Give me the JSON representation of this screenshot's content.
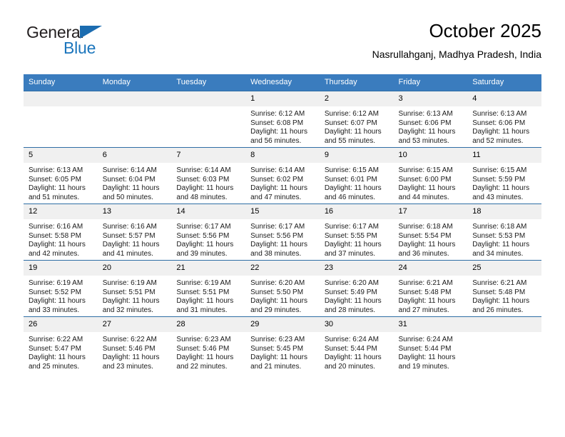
{
  "brand": {
    "name_part1": "General",
    "name_part2": "Blue",
    "flag_icon": "flag-triangle-icon",
    "accent_color": "#1b75bc"
  },
  "header": {
    "title": "October 2025",
    "location": "Nasrullahganj, Madhya Pradesh, India"
  },
  "theme": {
    "header_row_bg": "#3a7cbe",
    "day_number_bg": "#f0f0f0",
    "row_divider": "#2f6ea5"
  },
  "weekdays": [
    "Sunday",
    "Monday",
    "Tuesday",
    "Wednesday",
    "Thursday",
    "Friday",
    "Saturday"
  ],
  "weeks": [
    [
      {
        "day": "",
        "empty": true
      },
      {
        "day": "",
        "empty": true
      },
      {
        "day": "",
        "empty": true
      },
      {
        "day": "1",
        "sunrise": "Sunrise: 6:12 AM",
        "sunset": "Sunset: 6:08 PM",
        "daylight": "Daylight: 11 hours and 56 minutes."
      },
      {
        "day": "2",
        "sunrise": "Sunrise: 6:12 AM",
        "sunset": "Sunset: 6:07 PM",
        "daylight": "Daylight: 11 hours and 55 minutes."
      },
      {
        "day": "3",
        "sunrise": "Sunrise: 6:13 AM",
        "sunset": "Sunset: 6:06 PM",
        "daylight": "Daylight: 11 hours and 53 minutes."
      },
      {
        "day": "4",
        "sunrise": "Sunrise: 6:13 AM",
        "sunset": "Sunset: 6:06 PM",
        "daylight": "Daylight: 11 hours and 52 minutes."
      }
    ],
    [
      {
        "day": "5",
        "sunrise": "Sunrise: 6:13 AM",
        "sunset": "Sunset: 6:05 PM",
        "daylight": "Daylight: 11 hours and 51 minutes."
      },
      {
        "day": "6",
        "sunrise": "Sunrise: 6:14 AM",
        "sunset": "Sunset: 6:04 PM",
        "daylight": "Daylight: 11 hours and 50 minutes."
      },
      {
        "day": "7",
        "sunrise": "Sunrise: 6:14 AM",
        "sunset": "Sunset: 6:03 PM",
        "daylight": "Daylight: 11 hours and 48 minutes."
      },
      {
        "day": "8",
        "sunrise": "Sunrise: 6:14 AM",
        "sunset": "Sunset: 6:02 PM",
        "daylight": "Daylight: 11 hours and 47 minutes."
      },
      {
        "day": "9",
        "sunrise": "Sunrise: 6:15 AM",
        "sunset": "Sunset: 6:01 PM",
        "daylight": "Daylight: 11 hours and 46 minutes."
      },
      {
        "day": "10",
        "sunrise": "Sunrise: 6:15 AM",
        "sunset": "Sunset: 6:00 PM",
        "daylight": "Daylight: 11 hours and 44 minutes."
      },
      {
        "day": "11",
        "sunrise": "Sunrise: 6:15 AM",
        "sunset": "Sunset: 5:59 PM",
        "daylight": "Daylight: 11 hours and 43 minutes."
      }
    ],
    [
      {
        "day": "12",
        "sunrise": "Sunrise: 6:16 AM",
        "sunset": "Sunset: 5:58 PM",
        "daylight": "Daylight: 11 hours and 42 minutes."
      },
      {
        "day": "13",
        "sunrise": "Sunrise: 6:16 AM",
        "sunset": "Sunset: 5:57 PM",
        "daylight": "Daylight: 11 hours and 41 minutes."
      },
      {
        "day": "14",
        "sunrise": "Sunrise: 6:17 AM",
        "sunset": "Sunset: 5:56 PM",
        "daylight": "Daylight: 11 hours and 39 minutes."
      },
      {
        "day": "15",
        "sunrise": "Sunrise: 6:17 AM",
        "sunset": "Sunset: 5:56 PM",
        "daylight": "Daylight: 11 hours and 38 minutes."
      },
      {
        "day": "16",
        "sunrise": "Sunrise: 6:17 AM",
        "sunset": "Sunset: 5:55 PM",
        "daylight": "Daylight: 11 hours and 37 minutes."
      },
      {
        "day": "17",
        "sunrise": "Sunrise: 6:18 AM",
        "sunset": "Sunset: 5:54 PM",
        "daylight": "Daylight: 11 hours and 36 minutes."
      },
      {
        "day": "18",
        "sunrise": "Sunrise: 6:18 AM",
        "sunset": "Sunset: 5:53 PM",
        "daylight": "Daylight: 11 hours and 34 minutes."
      }
    ],
    [
      {
        "day": "19",
        "sunrise": "Sunrise: 6:19 AM",
        "sunset": "Sunset: 5:52 PM",
        "daylight": "Daylight: 11 hours and 33 minutes."
      },
      {
        "day": "20",
        "sunrise": "Sunrise: 6:19 AM",
        "sunset": "Sunset: 5:51 PM",
        "daylight": "Daylight: 11 hours and 32 minutes."
      },
      {
        "day": "21",
        "sunrise": "Sunrise: 6:19 AM",
        "sunset": "Sunset: 5:51 PM",
        "daylight": "Daylight: 11 hours and 31 minutes."
      },
      {
        "day": "22",
        "sunrise": "Sunrise: 6:20 AM",
        "sunset": "Sunset: 5:50 PM",
        "daylight": "Daylight: 11 hours and 29 minutes."
      },
      {
        "day": "23",
        "sunrise": "Sunrise: 6:20 AM",
        "sunset": "Sunset: 5:49 PM",
        "daylight": "Daylight: 11 hours and 28 minutes."
      },
      {
        "day": "24",
        "sunrise": "Sunrise: 6:21 AM",
        "sunset": "Sunset: 5:48 PM",
        "daylight": "Daylight: 11 hours and 27 minutes."
      },
      {
        "day": "25",
        "sunrise": "Sunrise: 6:21 AM",
        "sunset": "Sunset: 5:48 PM",
        "daylight": "Daylight: 11 hours and 26 minutes."
      }
    ],
    [
      {
        "day": "26",
        "sunrise": "Sunrise: 6:22 AM",
        "sunset": "Sunset: 5:47 PM",
        "daylight": "Daylight: 11 hours and 25 minutes."
      },
      {
        "day": "27",
        "sunrise": "Sunrise: 6:22 AM",
        "sunset": "Sunset: 5:46 PM",
        "daylight": "Daylight: 11 hours and 23 minutes."
      },
      {
        "day": "28",
        "sunrise": "Sunrise: 6:23 AM",
        "sunset": "Sunset: 5:46 PM",
        "daylight": "Daylight: 11 hours and 22 minutes."
      },
      {
        "day": "29",
        "sunrise": "Sunrise: 6:23 AM",
        "sunset": "Sunset: 5:45 PM",
        "daylight": "Daylight: 11 hours and 21 minutes."
      },
      {
        "day": "30",
        "sunrise": "Sunrise: 6:24 AM",
        "sunset": "Sunset: 5:44 PM",
        "daylight": "Daylight: 11 hours and 20 minutes."
      },
      {
        "day": "31",
        "sunrise": "Sunrise: 6:24 AM",
        "sunset": "Sunset: 5:44 PM",
        "daylight": "Daylight: 11 hours and 19 minutes."
      },
      {
        "day": "",
        "empty": true
      }
    ]
  ]
}
